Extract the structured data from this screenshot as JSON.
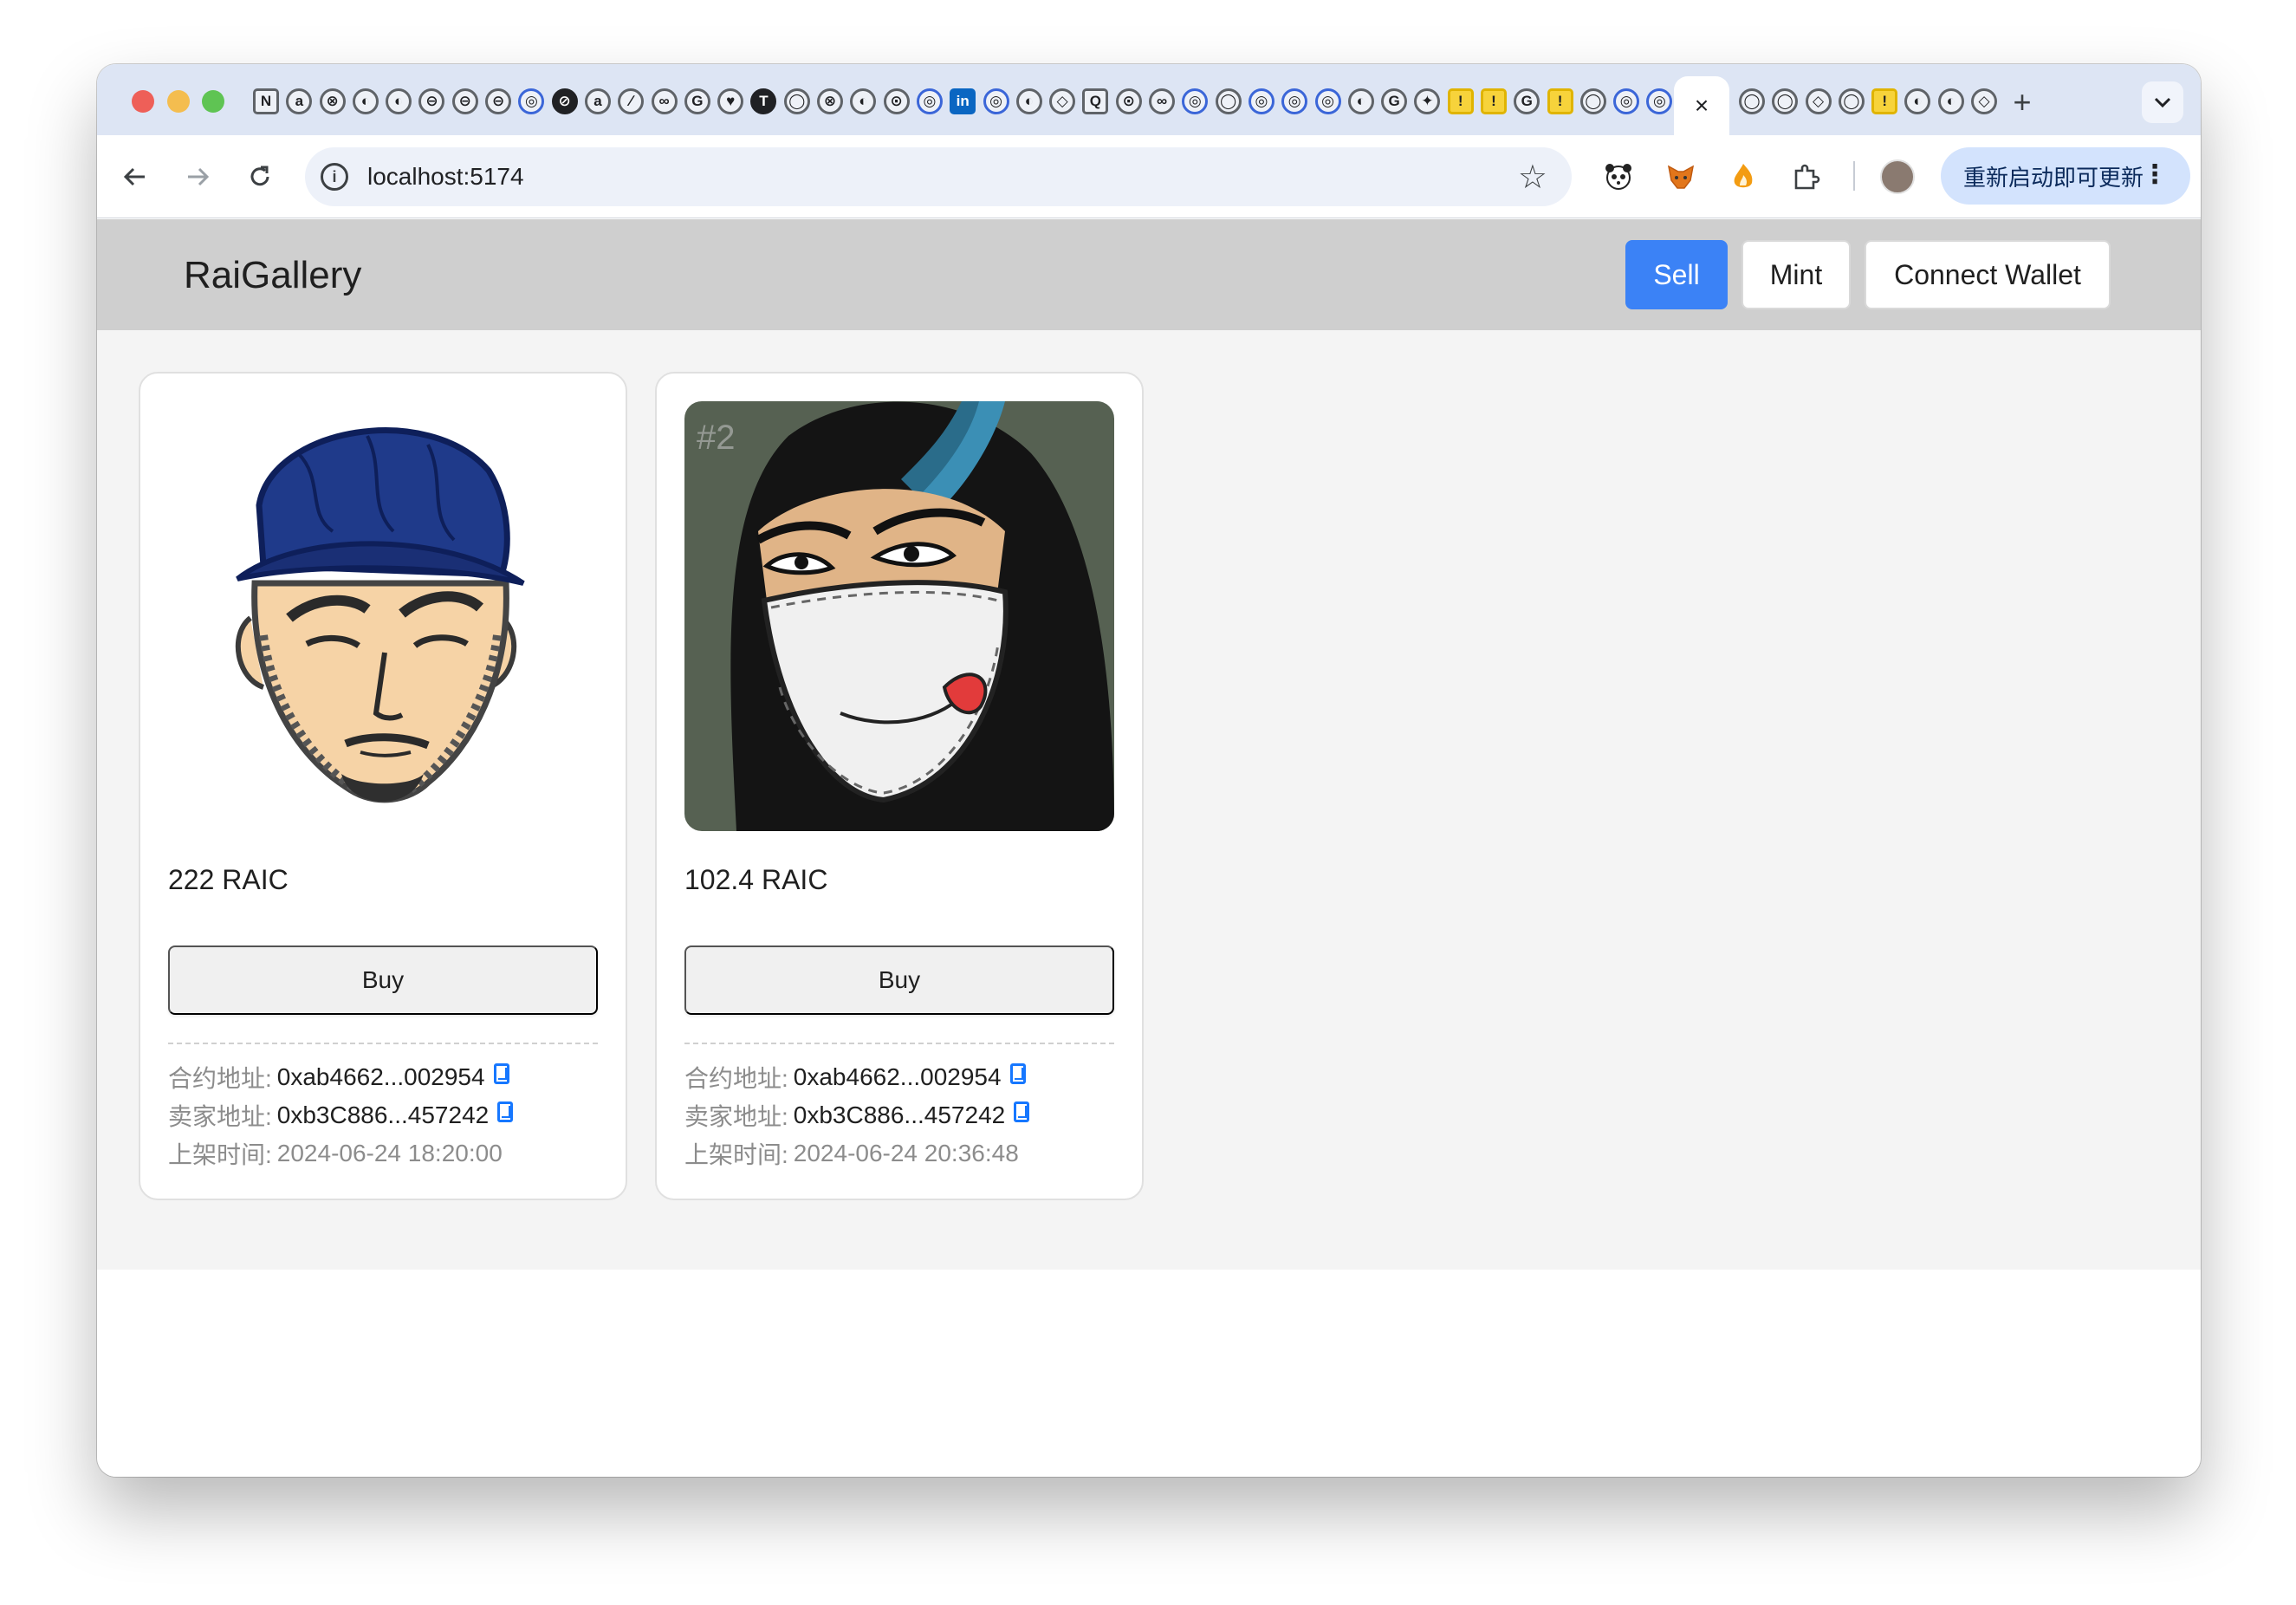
{
  "browser": {
    "url": "localhost:5174",
    "update_label": "重新启动即可更新",
    "new_tab_label": "+",
    "close_tab_label": "×",
    "tab_favicons": [
      "N",
      "a",
      "⊗",
      "◐",
      "◐",
      "⊖",
      "⊖",
      "⊖",
      "◎",
      "⊘",
      "a",
      "∕",
      "∞",
      "G",
      "♥",
      "T",
      "◯",
      "⊗",
      "◐",
      "⊙",
      "◎",
      "in",
      "◎",
      "◐",
      "◇",
      "Q",
      "⊙",
      "∞",
      "◎",
      "◯",
      "◎",
      "◎",
      "◎",
      "◐",
      "G",
      "✦",
      "!",
      "!",
      "G",
      "!",
      "◯",
      "◎",
      "◎",
      "◯"
    ],
    "tab_favicons_right": [
      "◯",
      "◯",
      "◇",
      "◯",
      "!",
      "◐",
      "◐",
      "◇"
    ]
  },
  "app": {
    "title": "RaiGallery",
    "buttons": {
      "sell": "Sell",
      "mint": "Mint",
      "connect": "Connect Wallet"
    }
  },
  "listings": [
    {
      "price": "222 RAIC",
      "buy_label": "Buy",
      "contract_label": "合约地址:",
      "contract_address": "0xab4662...002954",
      "seller_label": "卖家地址:",
      "seller_address": "0xb3C886...457242",
      "listed_label": "上架时间:",
      "listed_time": "2024-06-24 18:20:00"
    },
    {
      "price": "102.4 RAIC",
      "buy_label": "Buy",
      "image_tag": "#2",
      "contract_label": "合约地址:",
      "contract_address": "0xab4662...002954",
      "seller_label": "卖家地址:",
      "seller_address": "0xb3C886...457242",
      "listed_label": "上架时间:",
      "listed_time": "2024-06-24 20:36:48"
    }
  ],
  "colors": {
    "sell_button": "#3b82f6",
    "header_bg": "#cfcfcf",
    "content_bg": "#f4f4f4",
    "copy_icon": "#1677ff"
  }
}
